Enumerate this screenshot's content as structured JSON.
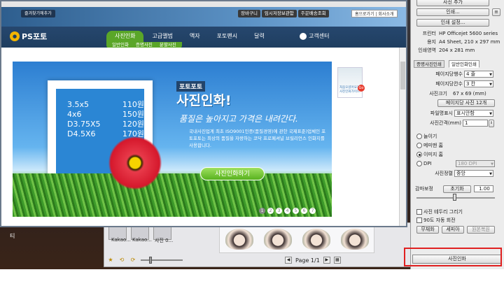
{
  "desktop": {
    "icon_label": "티"
  },
  "host_app": {
    "thumbnails": [
      "Kakao...",
      "Kakao...",
      "사진 0..."
    ],
    "page_label": "Page 1/1"
  },
  "browser": {
    "bookmark_btn": "즐겨찾기에추가",
    "top_links": [
      "장바구니",
      "임시저장보관함",
      "주문배송조회"
    ],
    "login_links": "홈으로가기 | 회사소개",
    "logo": "PS포토",
    "menu": [
      "사진인화",
      "고급앨범",
      "액자",
      "포토팬시",
      "달력"
    ],
    "menu_extra": "고객센터",
    "submenu": [
      "일반인화",
      "증명사진",
      "분할사진"
    ],
    "banner": {
      "brand": "포토포토",
      "title": "사진인화!",
      "slogan": "품질은 높아지고 가격은 내려간다.",
      "desc": "국내사진업계 최초 ISO9001인증(품질경영)에 관한 국제표준)업체인 포토포토는 최상의 품질을 자랑하는 코닥 프로페셔널 브릴리언스 인화지를 사용합니다.",
      "prices": [
        {
          "size": "3.5x5",
          "price": "110원"
        },
        {
          "size": "4x6",
          "price": "150원"
        },
        {
          "size": "D3.75X5",
          "price": "120원"
        },
        {
          "size": "D4.5X6",
          "price": "170원"
        }
      ],
      "cta": "사진인화하기",
      "pager": [
        "1",
        "2",
        "3",
        "4",
        "5",
        "6",
        "7"
      ],
      "active_page": 0
    },
    "side_ad": {
      "text": "처음오셨어요? 사진인화가이드",
      "badge": "Go"
    }
  },
  "panel": {
    "add_photo": "사진 추가",
    "print_setup_btn": "인쇄...",
    "print_settings_btn": "인쇄 설정...",
    "printer_label": "프린터",
    "printer_value": "HP Officejet 5600 series",
    "paper_label": "용지",
    "paper_value": "A4 Sheet, 210 x 297 mm",
    "print_area_label": "인쇄영역",
    "print_area_value": "204 x 281 mm",
    "tabs": [
      "증명사진인쇄",
      "일반인화인쇄"
    ],
    "active_tab": 1,
    "per_page_label": "페이지당행수",
    "per_page_value": "4 줄",
    "per_page_col_label": "페이지당칸수",
    "per_page_col_value": "3 칸",
    "photo_size_label": "사진크기",
    "photo_size_value": "67 x 69 (mm)",
    "per_page_photos": "페이지당 사진 12개",
    "filename_label": "파일명표시",
    "filename_value": "표시안함",
    "spacing_label": "사진간격(mm)",
    "spacing_value": "1",
    "radios": [
      "늘이기",
      "메미맨 홈",
      "이미지 홈",
      "DPI"
    ],
    "radio_selected": 2,
    "dpi_value": "180 DPI",
    "align_label": "사진정렬",
    "align_value": "중앙",
    "brightness_label": "감마보정",
    "brightness_btn": "초기화",
    "brightness_value": "1.00",
    "checkboxes": [
      "사진 테두리 그리기",
      "90도 자동 회전"
    ],
    "bottom_btns": [
      "무채화",
      "세피아",
      "원본복원"
    ],
    "print_btn": "사진인화"
  }
}
